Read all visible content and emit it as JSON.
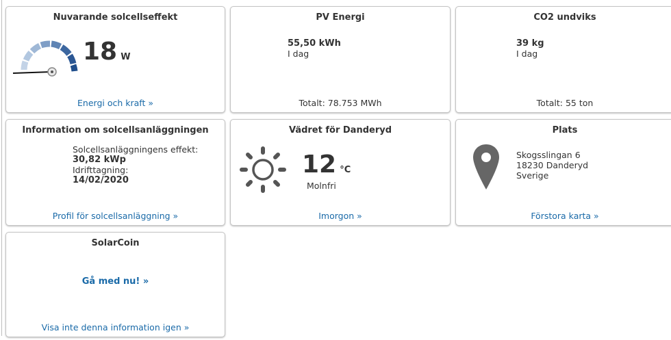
{
  "power": {
    "title": "Nuvarande solcellseffekt",
    "value": "18",
    "unit": "W",
    "link": "Energi och kraft »",
    "icon": "gauge-icon",
    "gauge_level_fraction": 0.0
  },
  "energy": {
    "title": "PV Energi",
    "today_value": "55,50 kWh",
    "today_label": "I dag",
    "total": "Totalt: 78.753 MWh"
  },
  "co2": {
    "title": "CO2 undviks",
    "today_value": "39 kg",
    "today_label": "I dag",
    "total": "Totalt: 55 ton"
  },
  "info": {
    "title": "Information om solcellsanläggningen",
    "power_label": "Solcellsanläggningens effekt:",
    "power_value": "30,82 kWp",
    "commission_label": "Idrifttagning:",
    "commission_value": "14/02/2020",
    "link": "Profil för solcellsanläggning »"
  },
  "weather": {
    "title": "Vädret för Danderyd",
    "temp": "12",
    "unit": "°C",
    "condition": "Molnfri",
    "link": "Imorgon »",
    "icon": "sun-icon",
    "icon_color": "#555555"
  },
  "location": {
    "title": "Plats",
    "street": "Skogsslingan 6",
    "city": "18230 Danderyd",
    "country": "Sverige",
    "link": "Förstora karta »",
    "icon": "map-pin-icon",
    "icon_color": "#666666"
  },
  "solarcoin": {
    "title": "SolarCoin",
    "join_link": "Gå med nu! »",
    "dismiss_link": "Visa inte denna information igen »"
  },
  "colors": {
    "link": "#1a6aa8",
    "gauge_dark": "#1f4e8c",
    "gauge_light": "#9fb8d6"
  }
}
